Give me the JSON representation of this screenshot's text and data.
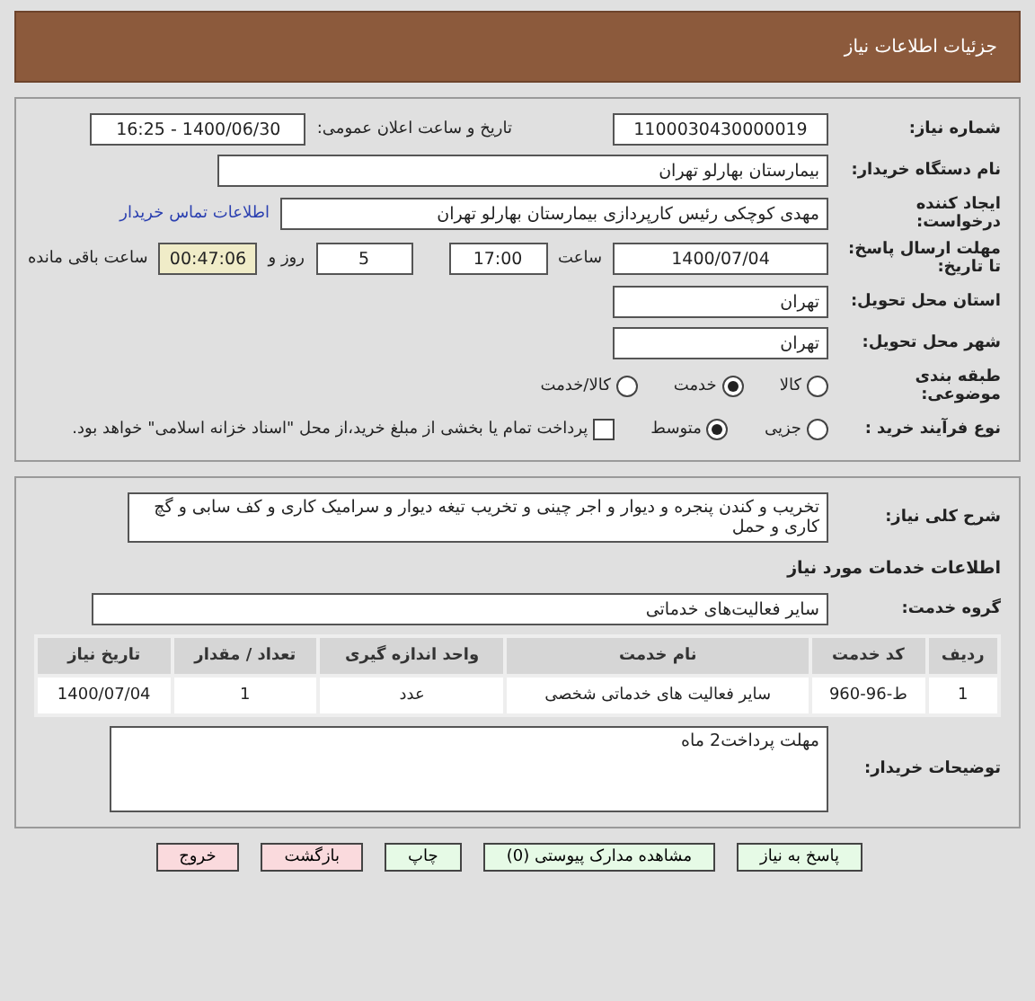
{
  "header": {
    "title": "جزئیات اطلاعات نیاز"
  },
  "summary": {
    "need_number": {
      "label": "شماره نیاز:",
      "value": "1100030430000019"
    },
    "announce": {
      "label": "تاریخ و ساعت اعلان عمومی:",
      "value": "1400/06/30 - 16:25"
    },
    "buyer": {
      "label": "نام دستگاه خریدار:",
      "value": "بیمارستان بهارلو تهران"
    },
    "requester": {
      "label": "ایجاد کننده درخواست:",
      "value": "مهدی کوچکی  رئیس کارپردازی بیمارستان بهارلو تهران",
      "link": "اطلاعات تماس خریدار"
    },
    "deadline": {
      "label": "مهلت ارسال پاسخ: تا تاریخ:",
      "date": "1400/07/04",
      "time_label": "ساعت",
      "time": "17:00",
      "days": "5",
      "days_label": "روز و",
      "remaining": "00:47:06",
      "remaining_label": "ساعت باقی مانده"
    },
    "province": {
      "label": "استان محل تحویل:",
      "value": "تهران"
    },
    "city": {
      "label": "شهر محل تحویل:",
      "value": "تهران"
    },
    "category": {
      "label": "طبقه بندی موضوعی:",
      "options": [
        {
          "label": "کالا",
          "selected": false
        },
        {
          "label": "خدمت",
          "selected": true
        },
        {
          "label": "کالا/خدمت",
          "selected": false
        }
      ]
    },
    "process": {
      "label": "نوع فرآیند خرید :",
      "options": [
        {
          "label": "جزیی",
          "selected": false
        },
        {
          "label": "متوسط",
          "selected": true
        }
      ],
      "payment": {
        "checked": false,
        "label": "پرداخت تمام یا بخشی از مبلغ خرید،از محل \"اسناد خزانه اسلامی\" خواهد بود."
      }
    }
  },
  "description": {
    "label": "شرح کلی نیاز:",
    "value": "تخریب و کندن پنجره و دیوار و اجر چینی  و تخریب تیغه دیوار و سرامیک کاری و کف سابی و گچ کاری و حمل"
  },
  "services": {
    "title": "اطلاعات خدمات مورد نیاز",
    "group": {
      "label": "گروه خدمت:",
      "value": "سایر فعالیت‌های خدماتی"
    },
    "columns": [
      "ردیف",
      "کد خدمت",
      "نام خدمت",
      "واحد اندازه گیری",
      "تعداد / مقدار",
      "تاریخ نیاز"
    ],
    "rows": [
      [
        "1",
        "ط-96-960",
        "سایر فعالیت های خدماتی شخصی",
        "عدد",
        "1",
        "1400/07/04"
      ]
    ]
  },
  "notes": {
    "label": "توضیحات خریدار:",
    "value": "مهلت پرداخت2 ماه"
  },
  "buttons": [
    {
      "label": "پاسخ به نیاز",
      "kind": "action"
    },
    {
      "label": "مشاهده مدارک پیوستی (0)",
      "kind": "action"
    },
    {
      "label": "چاپ",
      "kind": "action"
    },
    {
      "label": "بازگشت",
      "kind": "exit"
    },
    {
      "label": "خروج",
      "kind": "exit"
    }
  ]
}
